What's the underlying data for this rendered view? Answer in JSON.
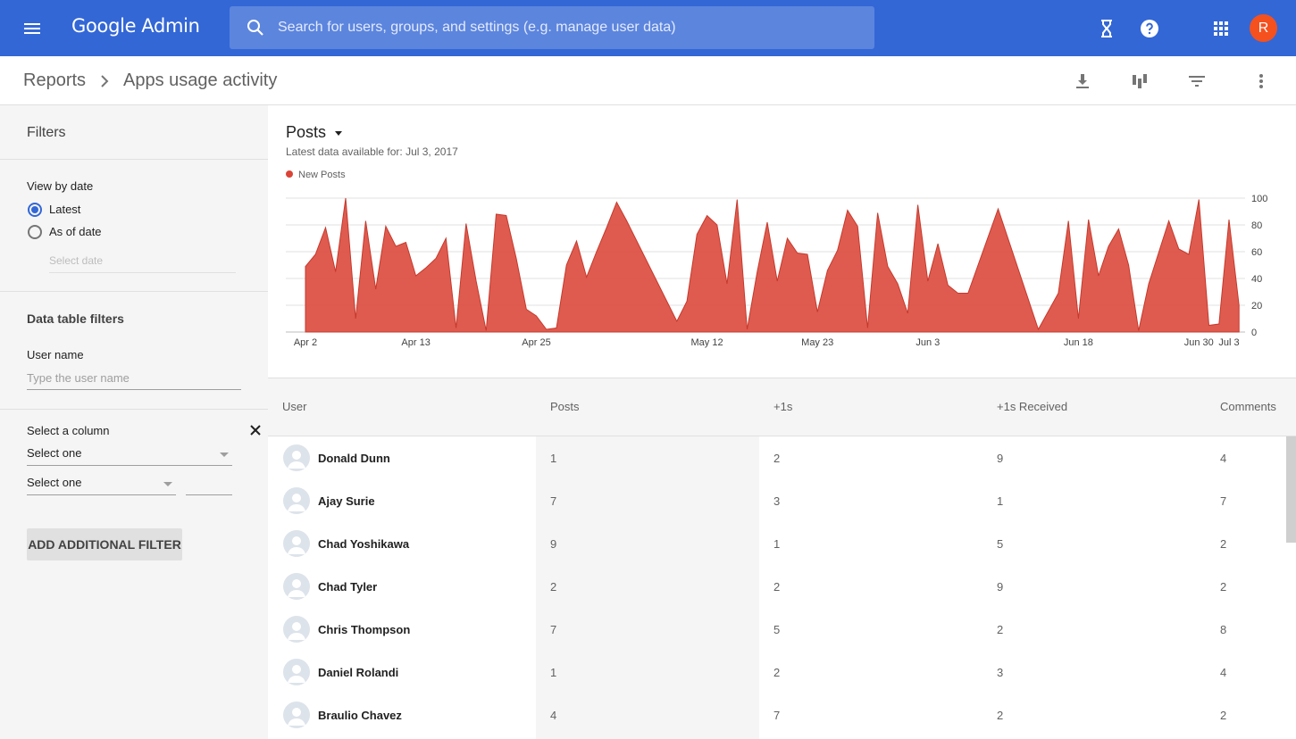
{
  "header": {
    "logo_google": "Google",
    "logo_admin": "Admin",
    "search_placeholder": "Search for users, groups, and settings (e.g. manage user data)",
    "avatar_letter": "R"
  },
  "breadcrumb": {
    "root": "Reports",
    "current": "Apps usage activity"
  },
  "filters": {
    "title": "Filters",
    "view_by_date_label": "View by date",
    "options": [
      "Latest",
      "As of date"
    ],
    "selected_option": "Latest",
    "select_date_placeholder": "Select date",
    "data_table_filters_title": "Data table filters",
    "user_name_label": "User name",
    "user_name_placeholder": "Type the user name",
    "select_column_label": "Select a column",
    "select_one_1": "Select one",
    "select_one_2": "Select one",
    "add_filter_label": "ADD ADDITIONAL FILTER"
  },
  "chart_data": {
    "type": "area",
    "title": "Posts",
    "subtitle": "Latest data available for: Jul 3, 2017",
    "series": [
      {
        "name": "New Posts",
        "color": "#db4437",
        "points": [
          [
            "2017-04-02",
            49
          ],
          [
            "2017-04-03",
            58
          ],
          [
            "2017-04-04",
            78
          ],
          [
            "2017-04-05",
            45
          ],
          [
            "2017-04-06",
            100
          ],
          [
            "2017-04-07",
            10
          ],
          [
            "2017-04-08",
            83
          ],
          [
            "2017-04-09",
            32
          ],
          [
            "2017-04-10",
            79
          ],
          [
            "2017-04-11",
            64
          ],
          [
            "2017-04-12",
            67
          ],
          [
            "2017-04-13",
            42
          ],
          [
            "2017-04-14",
            48
          ],
          [
            "2017-04-15",
            55
          ],
          [
            "2017-04-16",
            70
          ],
          [
            "2017-04-17",
            3
          ],
          [
            "2017-04-18",
            81
          ],
          [
            "2017-04-19",
            38
          ],
          [
            "2017-04-20",
            1
          ],
          [
            "2017-04-21",
            88
          ],
          [
            "2017-04-22",
            87
          ],
          [
            "2017-04-23",
            55
          ],
          [
            "2017-04-24",
            17
          ],
          [
            "2017-04-25",
            12
          ],
          [
            "2017-04-26",
            2
          ],
          [
            "2017-04-27",
            3
          ],
          [
            "2017-04-28",
            50
          ],
          [
            "2017-04-29",
            68
          ],
          [
            "2017-04-30",
            41
          ],
          [
            "2017-05-01",
            60
          ],
          [
            "2017-05-02",
            78
          ],
          [
            "2017-05-03",
            97
          ],
          [
            "2017-05-04",
            83
          ],
          [
            "2017-05-09",
            8
          ],
          [
            "2017-05-10",
            23
          ],
          [
            "2017-05-11",
            73
          ],
          [
            "2017-05-12",
            87
          ],
          [
            "2017-05-13",
            80
          ],
          [
            "2017-05-14",
            36
          ],
          [
            "2017-05-15",
            99
          ],
          [
            "2017-05-16",
            2
          ],
          [
            "2017-05-17",
            45
          ],
          [
            "2017-05-18",
            82
          ],
          [
            "2017-05-19",
            38
          ],
          [
            "2017-05-20",
            70
          ],
          [
            "2017-05-21",
            59
          ],
          [
            "2017-05-22",
            58
          ],
          [
            "2017-05-23",
            15
          ],
          [
            "2017-05-24",
            46
          ],
          [
            "2017-05-25",
            61
          ],
          [
            "2017-05-26",
            91
          ],
          [
            "2017-05-27",
            79
          ],
          [
            "2017-05-28",
            3
          ],
          [
            "2017-05-29",
            89
          ],
          [
            "2017-05-30",
            49
          ],
          [
            "2017-05-31",
            36
          ],
          [
            "2017-06-01",
            14
          ],
          [
            "2017-06-02",
            95
          ],
          [
            "2017-06-03",
            38
          ],
          [
            "2017-06-04",
            66
          ],
          [
            "2017-06-05",
            35
          ],
          [
            "2017-06-06",
            29
          ],
          [
            "2017-06-07",
            29
          ],
          [
            "2017-06-10",
            92
          ],
          [
            "2017-06-14",
            2
          ],
          [
            "2017-06-16",
            29
          ],
          [
            "2017-06-17",
            83
          ],
          [
            "2017-06-18",
            10
          ],
          [
            "2017-06-19",
            84
          ],
          [
            "2017-06-20",
            42
          ],
          [
            "2017-06-21",
            64
          ],
          [
            "2017-06-22",
            77
          ],
          [
            "2017-06-23",
            50
          ],
          [
            "2017-06-24",
            1
          ],
          [
            "2017-06-25",
            36
          ],
          [
            "2017-06-27",
            83
          ],
          [
            "2017-06-28",
            62
          ],
          [
            "2017-06-29",
            58
          ],
          [
            "2017-06-30",
            99
          ],
          [
            "2017-07-01",
            5
          ],
          [
            "2017-07-02",
            6
          ],
          [
            "2017-07-03",
            84
          ],
          [
            "2017-07-04",
            20
          ]
        ]
      }
    ],
    "x_ticks": [
      {
        "label": "Apr 2",
        "date": "2017-04-02"
      },
      {
        "label": "Apr 13",
        "date": "2017-04-13"
      },
      {
        "label": "Apr 25",
        "date": "2017-04-25"
      },
      {
        "label": "May 12",
        "date": "2017-05-12"
      },
      {
        "label": "May 23",
        "date": "2017-05-23"
      },
      {
        "label": "Jun 3",
        "date": "2017-06-03"
      },
      {
        "label": "Jun 18",
        "date": "2017-06-18"
      },
      {
        "label": "Jun 30",
        "date": "2017-06-30"
      },
      {
        "label": "Jul 3",
        "date": "2017-07-03"
      }
    ],
    "y_ticks": [
      0,
      20,
      40,
      60,
      80,
      100
    ],
    "ylim": [
      0,
      100
    ],
    "y_axis_position": "right",
    "grid": true,
    "legend_position": "top-left"
  },
  "table": {
    "columns": [
      "User",
      "Posts",
      "+1s",
      "+1s Received",
      "Comments"
    ],
    "rows": [
      {
        "user": "Donald Dunn",
        "posts": "1",
        "plus_ones": "2",
        "plus_ones_received": "9",
        "comments": "4"
      },
      {
        "user": "Ajay Surie",
        "posts": "7",
        "plus_ones": "3",
        "plus_ones_received": "1",
        "comments": "7"
      },
      {
        "user": "Chad Yoshikawa",
        "posts": "9",
        "plus_ones": "1",
        "plus_ones_received": "5",
        "comments": "2"
      },
      {
        "user": "Chad Tyler",
        "posts": "2",
        "plus_ones": "2",
        "plus_ones_received": "9",
        "comments": "2"
      },
      {
        "user": "Chris Thompson",
        "posts": "7",
        "plus_ones": "5",
        "plus_ones_received": "2",
        "comments": "8"
      },
      {
        "user": "Daniel Rolandi",
        "posts": "1",
        "plus_ones": "2",
        "plus_ones_received": "3",
        "comments": "4"
      },
      {
        "user": "Braulio Chavez",
        "posts": "4",
        "plus_ones": "7",
        "plus_ones_received": "2",
        "comments": "2"
      }
    ]
  },
  "icons": [
    "menu-icon",
    "search-icon",
    "hourglass-icon",
    "help-icon",
    "apps-grid-icon",
    "chevron-right-icon",
    "download-icon",
    "chart-columns-icon",
    "filter-icon",
    "more-vert-icon",
    "close-icon",
    "person-icon"
  ],
  "colors": {
    "topbar": "#3367d6",
    "search_box": "#5c85de",
    "avatar": "#f4511e",
    "series": "#db4437",
    "radio_selected": "#3367d6"
  }
}
